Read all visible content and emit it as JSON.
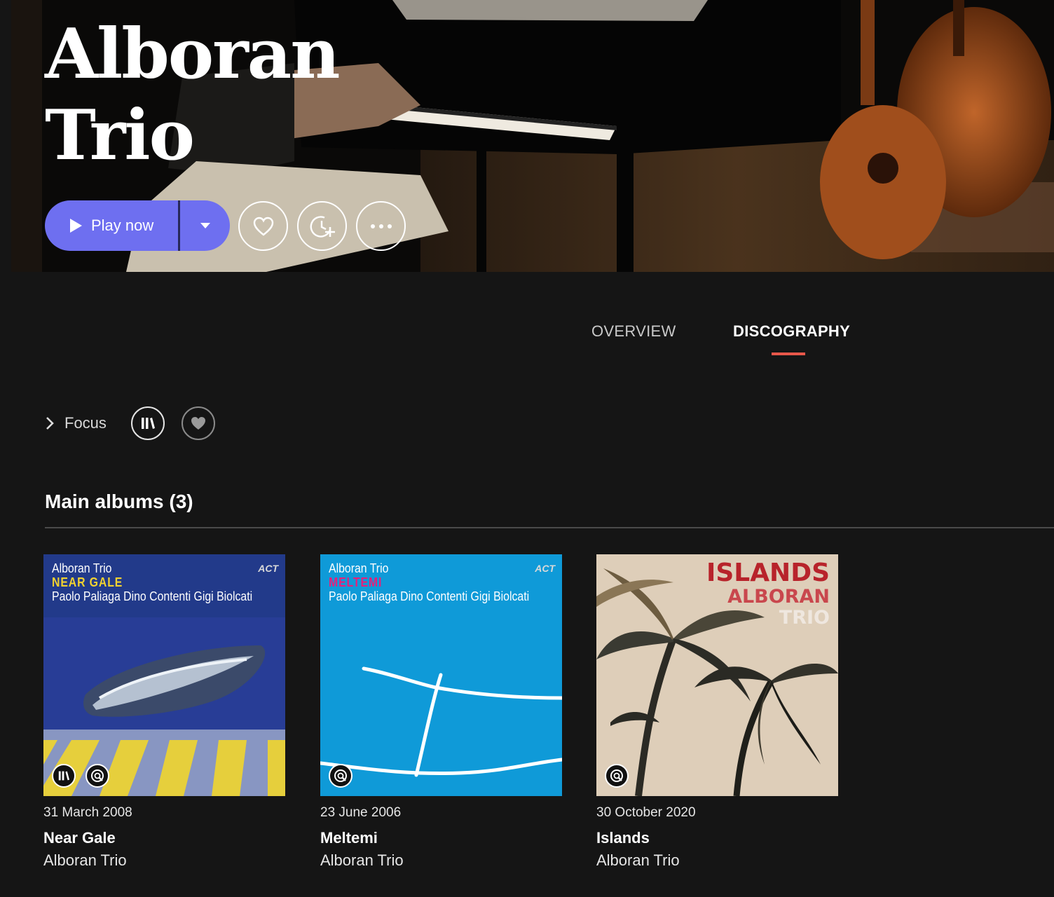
{
  "artist": {
    "name_line1": "Alboran",
    "name_line2": "Trio"
  },
  "actions": {
    "play_label": "Play now"
  },
  "tabs": [
    {
      "label": "OVERVIEW",
      "active": false
    },
    {
      "label": "DISCOGRAPHY",
      "active": true
    }
  ],
  "filters": {
    "focus_label": "Focus"
  },
  "section": {
    "title": "Main albums (3)"
  },
  "albums": [
    {
      "date": "31 March 2008",
      "title": "Near Gale",
      "artist": "Alboran Trio",
      "cover": {
        "artist": "Alboran Trio",
        "album": "NEAR GALE",
        "musicians": "Paolo Paliaga  Dino Contenti  Gigi Biolcati",
        "label": "ACT"
      }
    },
    {
      "date": "23 June 2006",
      "title": "Meltemi",
      "artist": "Alboran Trio",
      "cover": {
        "artist": "Alboran Trio",
        "album": "MELTEMI",
        "musicians": "Paolo Paliaga  Dino Contenti  Gigi Biolcati",
        "label": "ACT"
      }
    },
    {
      "date": "30 October 2020",
      "title": "Islands",
      "artist": "Alboran Trio",
      "cover": {
        "line1": "ISLANDS",
        "line2": "ALBORAN",
        "line3": "TRIO"
      }
    }
  ],
  "colors": {
    "accent": "#6e6ff0",
    "tab_underline": "#e8574a",
    "background": "#151515"
  }
}
